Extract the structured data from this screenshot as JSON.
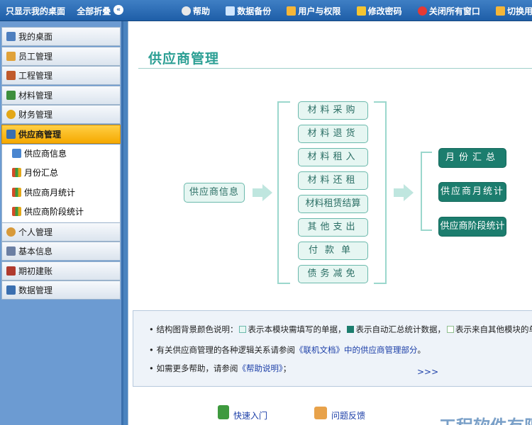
{
  "topbar": {
    "show_desktop": "只显示我的桌面",
    "collapse_all": "全部折叠",
    "items": [
      {
        "label": "帮助",
        "icon": "help-icon",
        "color": "#e8e8e8"
      },
      {
        "label": "数据备份",
        "icon": "database-icon",
        "color": "#cfe6ff"
      },
      {
        "label": "用户与权限",
        "icon": "users-icon",
        "color": "#f5b638"
      },
      {
        "label": "修改密码",
        "icon": "key-icon",
        "color": "#f5c531"
      },
      {
        "label": "关闭所有窗口",
        "icon": "close-icon",
        "color": "#e53935"
      },
      {
        "label": "切换用户",
        "icon": "switch-user-icon",
        "color": "#f5b638"
      }
    ]
  },
  "sidebar": {
    "items": [
      {
        "label": "我的桌面",
        "icon": "desktop-icon",
        "color": "#4e7fbf"
      },
      {
        "label": "员工管理",
        "icon": "staff-icon",
        "color": "#e0a23a"
      },
      {
        "label": "工程管理",
        "icon": "home-icon",
        "color": "#c05a2c"
      },
      {
        "label": "材料管理",
        "icon": "materials-icon",
        "color": "#3e8f3e"
      },
      {
        "label": "财务管理",
        "icon": "finance-icon",
        "color": "#e3a718"
      },
      {
        "label": "供应商管理",
        "icon": "supplier-icon",
        "color": "#3a6fb0"
      }
    ],
    "subitems": [
      {
        "label": "供应商信息",
        "icon": "doc-icon",
        "color": "#4a86d0"
      },
      {
        "label": "月份汇总",
        "icon": "bar-chart-icon",
        "color": "#d44b28"
      },
      {
        "label": "供应商月统计",
        "icon": "bar-chart-icon",
        "color": "#d44b28"
      },
      {
        "label": "供应商阶段统计",
        "icon": "bar-chart-icon",
        "color": "#d44b28"
      }
    ],
    "items_after": [
      {
        "label": "个人管理",
        "icon": "person-icon",
        "color": "#d89a3a"
      },
      {
        "label": "基本信息",
        "icon": "info-icon",
        "color": "#6b7fa3"
      },
      {
        "label": "期初建账",
        "icon": "book-icon",
        "color": "#b03a2e"
      },
      {
        "label": "数据管理",
        "icon": "db-icon",
        "color": "#3a6fb0"
      }
    ]
  },
  "main": {
    "title": "供应商管理",
    "source_box": "供应商信息",
    "middle_boxes": [
      "材料采购",
      "材料退货",
      "材料租入",
      "材料还租",
      "材料租赁结算",
      "其他支出",
      "付款单",
      "债务减免"
    ],
    "right_boxes": [
      "月份汇总",
      "供应商月统计",
      "供应商阶段统计"
    ],
    "info": {
      "line1_prefix": "结构图背景颜色说明：",
      "line1_a": "表示本模块需填写的单据，",
      "line1_b": "表示自动汇总统计数据，",
      "line1_c": "表示来自其他模块的单据。",
      "line2_prefix": "有关供应商管理的各种逻辑关系请参阅",
      "line2_link": "《联机文档》中的供应商管理部分",
      "line2_suffix": "。",
      "line3_prefix": "如需更多帮助，请参阅",
      "line3_link": "《帮助说明》",
      "line3_suffix": "；",
      "more": ">>>"
    },
    "footer": {
      "quick_start": "快速入门",
      "feedback": "问题反馈",
      "company": "工程软件有限"
    }
  }
}
